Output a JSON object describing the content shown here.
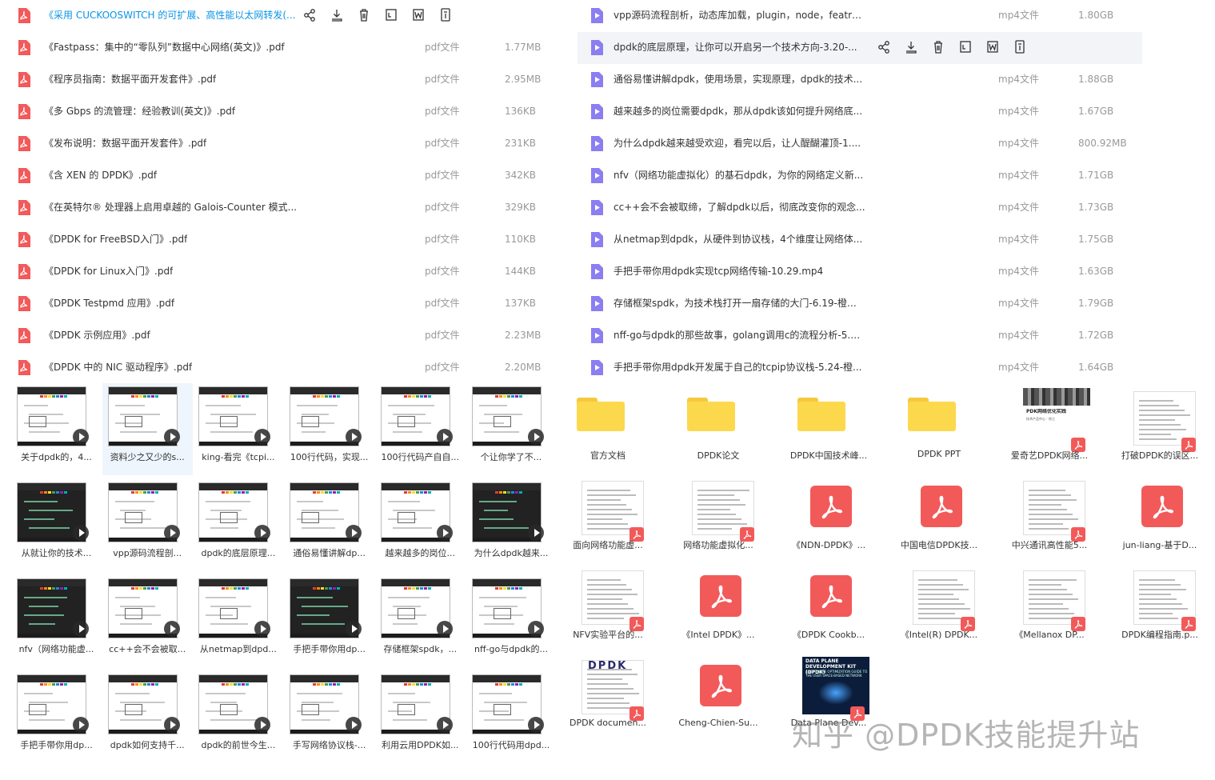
{
  "colors": {
    "pdf_red": "#f25a5a",
    "video_purple": "#8a7ef0",
    "active_blue": "#0a94e8",
    "folder_yellow": "#fcd84d"
  },
  "left_list": [
    {
      "name": "《采用 CUCKOOSWITCH 的可扩展、高性能以太网转发(...",
      "icon": "pdf-icon",
      "active": true,
      "type": "",
      "size": ""
    },
    {
      "name": "《Fastpass：集中的“零队列”数据中心网络(英文)》.pdf",
      "icon": "pdf-icon",
      "type": "pdf文件",
      "size": "1.77MB"
    },
    {
      "name": "《程序员指南：数据平面开发套件》.pdf",
      "icon": "pdf-icon",
      "type": "pdf文件",
      "size": "2.95MB"
    },
    {
      "name": "《多 Gbps 的流管理：经验教训(英文)》.pdf",
      "icon": "pdf-icon",
      "type": "pdf文件",
      "size": "136KB"
    },
    {
      "name": "《发布说明：数据平面开发套件》.pdf",
      "icon": "pdf-icon",
      "type": "pdf文件",
      "size": "231KB"
    },
    {
      "name": "《含 XEN 的 DPDK》.pdf",
      "icon": "pdf-icon",
      "type": "pdf文件",
      "size": "342KB"
    },
    {
      "name": "《在英特尔® 处理器上启用卓越的 Galois-Counter 模式...",
      "icon": "pdf-icon",
      "type": "pdf文件",
      "size": "329KB"
    },
    {
      "name": "《DPDK for FreeBSD入门》.pdf",
      "icon": "pdf-icon",
      "type": "pdf文件",
      "size": "110KB"
    },
    {
      "name": "《DPDK for Linux入门》.pdf",
      "icon": "pdf-icon",
      "type": "pdf文件",
      "size": "144KB"
    },
    {
      "name": "《DPDK Testpmd 应用》.pdf",
      "icon": "pdf-icon",
      "type": "pdf文件",
      "size": "137KB"
    },
    {
      "name": "《DPDK 示例应用》.pdf",
      "icon": "pdf-icon",
      "type": "pdf文件",
      "size": "2.23MB"
    },
    {
      "name": "《DPDK 中的 NIC 驱动程序》.pdf",
      "icon": "pdf-icon",
      "type": "pdf文件",
      "size": "2.20MB"
    }
  ],
  "right_list": [
    {
      "name": "vpp源码流程剖析，动态库加载，plugin，node，featru...",
      "type": "mp4文件",
      "size": "1.80GB"
    },
    {
      "name": "dpdk的底层原理，让你可以开启另一个技术方向-3.20-...",
      "type": "",
      "size": "",
      "hover": true
    },
    {
      "name": "通俗易懂讲解dpdk，使用场景，实现原理，dpdk的技术...",
      "type": "mp4文件",
      "size": "1.88GB"
    },
    {
      "name": "越来越多的岗位需要dpdk，那从dpdk该如何提升网络底...",
      "type": "mp4文件",
      "size": "1.67GB"
    },
    {
      "name": "为什么dpdk越来越受欢迎，看完以后，让人醍醐灌顶-1....",
      "type": "mp4文件",
      "size": "800.92MB"
    },
    {
      "name": "nfv（网络功能虚拟化）的基石dpdk，为你的网络定义新...",
      "type": "mp4文件",
      "size": "1.71GB"
    },
    {
      "name": "cc++会不会被取缔，了解dpdk以后，彻底改变你的观念...",
      "type": "mp4文件",
      "size": "1.73GB"
    },
    {
      "name": "从netmap到dpdk，从硬件到协议栈，4个维度让网络体...",
      "type": "mp4文件",
      "size": "1.75GB"
    },
    {
      "name": "手把手带你用dpdk实现tcp网络传输-10.29.mp4",
      "type": "mp4文件",
      "size": "1.63GB"
    },
    {
      "name": "存储框架spdk，为技术栈打开一扇存储的大门-6.19-橙子...",
      "type": "mp4文件",
      "size": "1.79GB"
    },
    {
      "name": "nff-go与dpdk的那些故事，golang调用c的流程分析-5.1...",
      "type": "mp4文件",
      "size": "1.72GB"
    },
    {
      "name": "手把手带你用dpdk开发属于自己的tcpip协议栈-5.24-橙...",
      "type": "mp4文件",
      "size": "1.64GB"
    }
  ],
  "row_actions": [
    "share-icon",
    "download-icon",
    "delete-icon",
    "terminal-icon",
    "word-icon",
    "info-icon"
  ],
  "videos": [
    {
      "caption": "关于dpdk的，4..."
    },
    {
      "caption": "资料少之又少的s...",
      "selected": true
    },
    {
      "caption": "king-看完《tcpi..."
    },
    {
      "caption": "100行代码，实现..."
    },
    {
      "caption": "100行代码产自自..."
    },
    {
      "caption": "个让你学了不..."
    },
    {
      "caption": "从就让你的技术..."
    },
    {
      "caption": "vpp源码流程剖..."
    },
    {
      "caption": "dpdk的底层原理..."
    },
    {
      "caption": "通俗易懂讲解dp..."
    },
    {
      "caption": "越来越多的岗位..."
    },
    {
      "caption": "为什么dpdk越来..."
    },
    {
      "caption": "nfv（网络功能虚..."
    },
    {
      "caption": "cc++会不会被取..."
    },
    {
      "caption": "从netmap到dpd..."
    },
    {
      "caption": "手把手带你用dp..."
    },
    {
      "caption": "存储框架spdk，..."
    },
    {
      "caption": "nff-go与dpdk的..."
    },
    {
      "caption": "手把手带你用dp..."
    },
    {
      "caption": "dpdk如何支持千..."
    },
    {
      "caption": "dpdk的前世今生..."
    },
    {
      "caption": "手写网络协议栈-..."
    },
    {
      "caption": "利用云用DPDK如..."
    },
    {
      "caption": "100行代码用dpd..."
    }
  ],
  "grid_items": [
    {
      "caption": "官方文档",
      "kind": "folder"
    },
    {
      "caption": "DPDK论文",
      "kind": "folder"
    },
    {
      "caption": "DPDK中国技术峰...",
      "kind": "folder"
    },
    {
      "caption": "DPDK  PPT",
      "kind": "folder"
    },
    {
      "caption": "爱奇艺DPDK网络...",
      "kind": "image",
      "thumb_title": "PDK网络优化实践",
      "thumb_sub": "技术产品中心 · 徐江"
    },
    {
      "caption": "打破DPDK的误区...",
      "kind": "doc"
    },
    {
      "caption": "面向网络功能虚...",
      "kind": "doc"
    },
    {
      "caption": "网络功能虚拟化...",
      "kind": "doc"
    },
    {
      "caption": "《NDN-DPDK》...",
      "kind": "pdf"
    },
    {
      "caption": "中国电信DPDK技...",
      "kind": "pdf"
    },
    {
      "caption": "中兴通讯高性能5...",
      "kind": "doc"
    },
    {
      "caption": "jun-liang-基于D...",
      "kind": "pdf"
    },
    {
      "caption": "NFV实验平台的...",
      "kind": "doc"
    },
    {
      "caption": "《Intel DPDK》...",
      "kind": "pdf"
    },
    {
      "caption": "《DPDK Cookb...",
      "kind": "pdf"
    },
    {
      "caption": "《Intel(R) DPDK...",
      "kind": "doc"
    },
    {
      "caption": "《Mellanox DP...",
      "kind": "doc"
    },
    {
      "caption": "DPDK编程指南.p...",
      "kind": "doc"
    },
    {
      "caption": "DPDK documen...",
      "kind": "doc",
      "thumb_title": "DPDK"
    },
    {
      "caption": "Cheng-Chien-Su...",
      "kind": "pdf"
    },
    {
      "caption": "Data Plane Dev...",
      "kind": "image",
      "thumb_title": "DATA PLANE DEVELOPMENT KIT (DPDK)",
      "thumb_sub": "A SOFTWARE OPTIMIZATION GUIDE TO THE USER SPACE-BASED NETWORK APPLICATIONS"
    }
  ],
  "watermark": "知乎 @DPDK技能提升站"
}
